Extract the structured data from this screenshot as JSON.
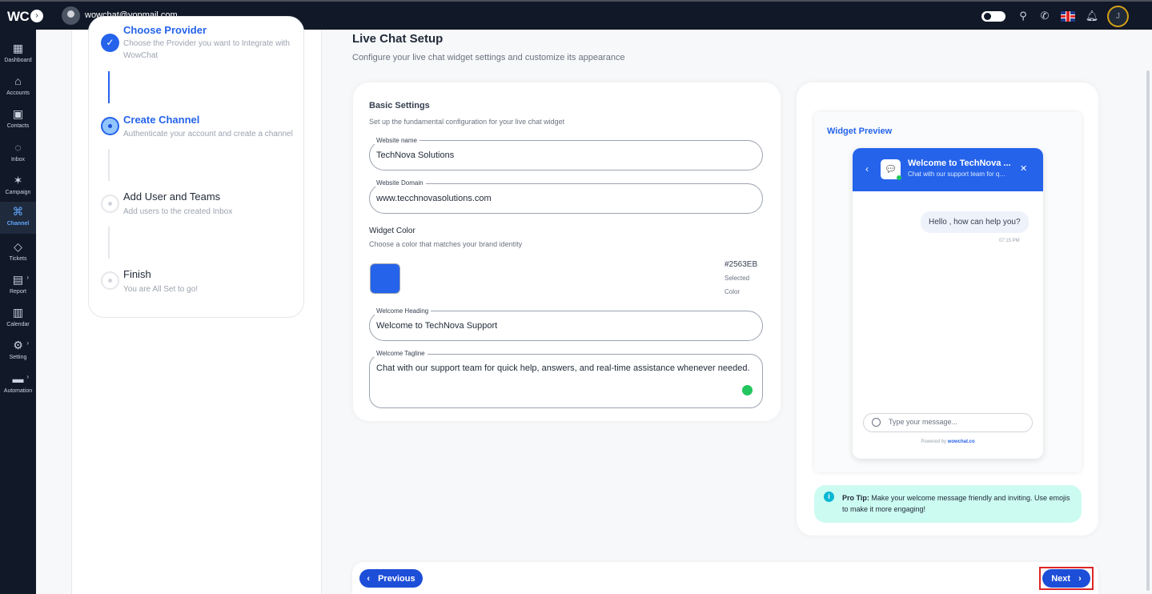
{
  "topbar": {
    "logo": "WC",
    "user_email": "wowchat@yopmail.com",
    "profile_initial": "J"
  },
  "sidebar": {
    "items": [
      {
        "label": "Dashboard",
        "icon": "grid-icon"
      },
      {
        "label": "Accounts",
        "icon": "home-icon"
      },
      {
        "label": "Contacts",
        "icon": "contact-icon"
      },
      {
        "label": "Inbox",
        "icon": "chat-icon"
      },
      {
        "label": "Campaign",
        "icon": "megaphone-icon"
      },
      {
        "label": "Channel",
        "icon": "channel-icon",
        "active": true
      },
      {
        "label": "Tickets",
        "icon": "ticket-icon"
      },
      {
        "label": "Report",
        "icon": "chart-icon"
      },
      {
        "label": "Calendar",
        "icon": "calendar-icon"
      },
      {
        "label": "Setting",
        "icon": "gear-icon"
      },
      {
        "label": "Automation",
        "icon": "truck-icon"
      }
    ]
  },
  "stepper": {
    "steps": [
      {
        "title": "Choose Provider",
        "desc": "Choose the Provider you want to Integrate with WowChat",
        "state": "done"
      },
      {
        "title": "Create Channel",
        "desc": "Authenticate your account and create a channel",
        "state": "active"
      },
      {
        "title": "Add User and Teams",
        "desc": "Add users to the created Inbox",
        "state": "pending"
      },
      {
        "title": "Finish",
        "desc": "You are All Set to go!",
        "state": "pending"
      }
    ]
  },
  "main": {
    "title": "Live Chat Setup",
    "subtitle": "Configure your live chat widget settings and customize its appearance"
  },
  "basic": {
    "title": "Basic Settings",
    "subtitle": "Set up the fundamental configuration for your live chat widget",
    "website_name_label": "Website name",
    "website_name": "TechNova Solutions",
    "website_domain_label": "Website Domain",
    "website_domain": "www.tecchnovasolutions.com",
    "widget_color_title": "Widget Color",
    "widget_color_sub": "Choose a color that matches your brand identity",
    "color_hex": "#2563EB",
    "selected_line1": "Selected",
    "selected_line2": "Color",
    "welcome_heading_label": "Welcome Heading",
    "welcome_heading": "Welcome to TechNova Support",
    "welcome_tagline_label": "Welcome Tagline",
    "welcome_tagline": "Chat with our support team for quick help, answers, and real-time assistance whenever needed."
  },
  "preview": {
    "title": "Widget Preview",
    "heading": "Welcome to TechNova ...",
    "tagline": "Chat with our support team for quic...",
    "message": "Hello , how can help you?",
    "time": "07:15 PM",
    "input_placeholder": "Type your message...",
    "powered_prefix": "Powered by",
    "powered_brand": "wowchat.co"
  },
  "tip": {
    "label": "Pro Tip:",
    "text": "Make your welcome message friendly and inviting. Use emojis to make it more engaging!"
  },
  "footer": {
    "previous": "Previous",
    "next": "Next"
  },
  "colors": {
    "accent": "#2563EB",
    "sidebar_bg": "#111827"
  }
}
